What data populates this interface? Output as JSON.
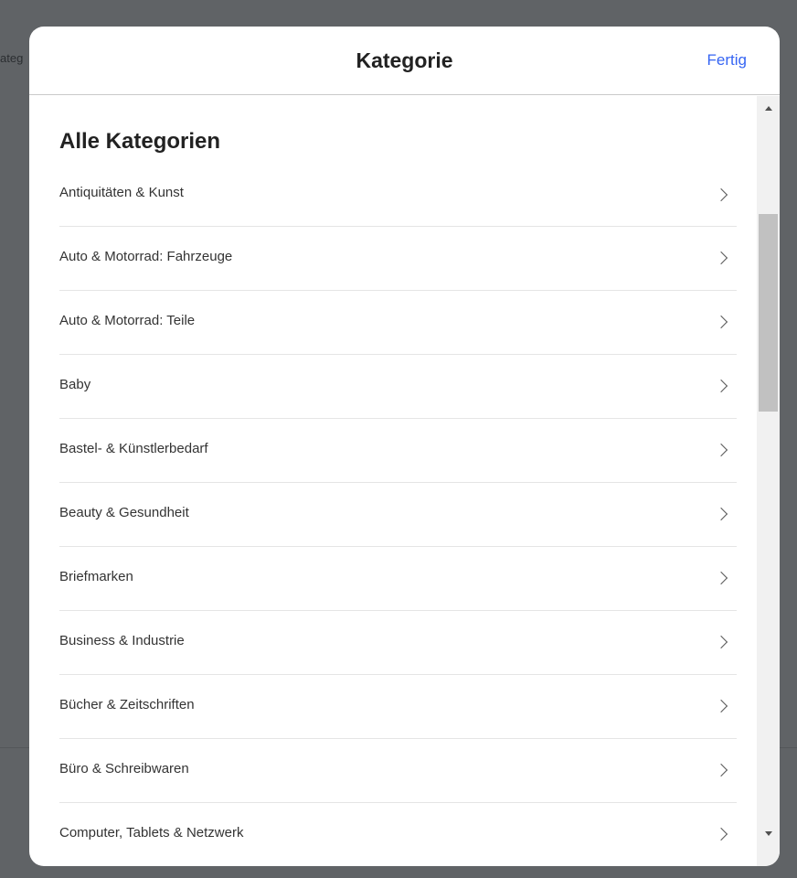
{
  "background": {
    "clipped_text": "ateg"
  },
  "modal": {
    "title": "Kategorie",
    "done_label": "Fertig",
    "section_heading": "Alle Kategorien",
    "categories": [
      {
        "label": "Antiquitäten & Kunst"
      },
      {
        "label": "Auto & Motorrad: Fahrzeuge"
      },
      {
        "label": "Auto & Motorrad: Teile"
      },
      {
        "label": "Baby"
      },
      {
        "label": "Bastel- & Künstlerbedarf"
      },
      {
        "label": "Beauty & Gesundheit"
      },
      {
        "label": "Briefmarken"
      },
      {
        "label": "Business & Industrie"
      },
      {
        "label": "Bücher & Zeitschriften"
      },
      {
        "label": "Büro & Schreibwaren"
      },
      {
        "label": "Computer, Tablets & Netzwerk"
      }
    ]
  },
  "colors": {
    "accent": "#3665f3",
    "overlay": "#5f6368"
  },
  "icons": {
    "item_chevron": "chevron-right-icon",
    "scroll_up": "arrow-up-icon",
    "scroll_down": "arrow-down-icon"
  }
}
